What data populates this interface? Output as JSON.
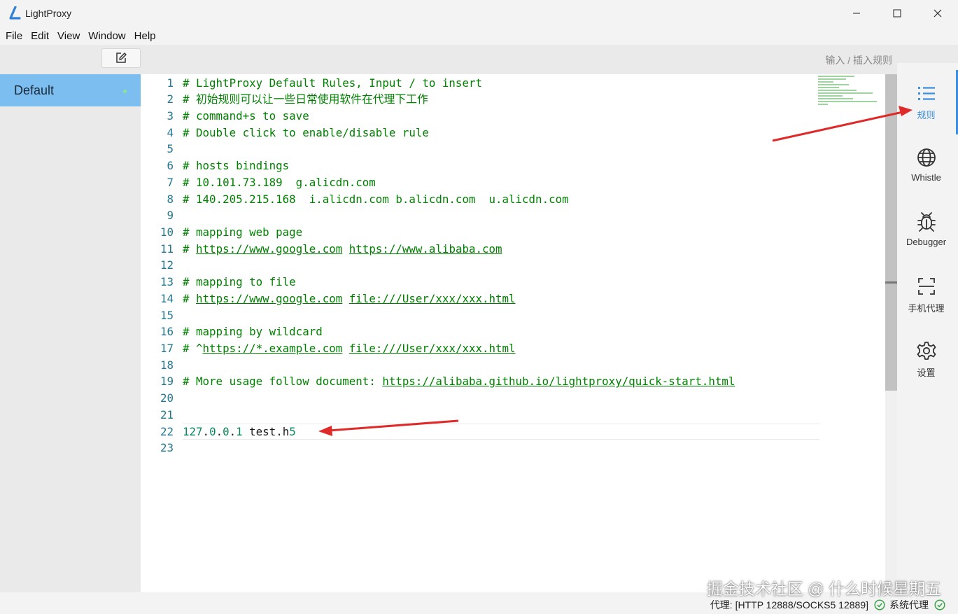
{
  "window": {
    "title": "LightProxy",
    "controls": [
      "minimize-icon",
      "maximize-icon",
      "close-icon"
    ]
  },
  "menu": [
    "File",
    "Edit",
    "Window",
    "Help",
    "View"
  ],
  "menu_order": [
    "File",
    "Edit",
    "View",
    "Window",
    "Help"
  ],
  "toolbar": {
    "new_rule_icon": "edit-icon",
    "hint": "输入 / 插入规则"
  },
  "sidebar": {
    "items": [
      {
        "label": "Default",
        "enabled": true
      }
    ]
  },
  "editor": {
    "lines": [
      {
        "n": "1",
        "text": "# LightProxy Default Rules, Input / to insert"
      },
      {
        "n": "2",
        "text": "# 初始规则可以让一些日常使用软件在代理下工作"
      },
      {
        "n": "3",
        "text": "# command+s to save"
      },
      {
        "n": "4",
        "text": "# Double click to enable/disable rule"
      },
      {
        "n": "5",
        "text": ""
      },
      {
        "n": "6",
        "text": "# hosts bindings"
      },
      {
        "n": "7",
        "text": "# 10.101.73.189  g.alicdn.com"
      },
      {
        "n": "8",
        "text": "# 140.205.215.168  i.alicdn.com b.alicdn.com  u.alicdn.com"
      },
      {
        "n": "9",
        "text": ""
      },
      {
        "n": "10",
        "text": "# mapping web page"
      },
      {
        "n": "11",
        "prefix": "# ",
        "links": [
          "https://www.google.com",
          "https://www.alibaba.com"
        ]
      },
      {
        "n": "12",
        "text": ""
      },
      {
        "n": "13",
        "text": "# mapping to file"
      },
      {
        "n": "14",
        "prefix": "# ",
        "links": [
          "https://www.google.com",
          "file:///User/xxx/xxx.html"
        ]
      },
      {
        "n": "15",
        "text": ""
      },
      {
        "n": "16",
        "text": "# mapping by wildcard"
      },
      {
        "n": "17",
        "prefix": "# ^",
        "links": [
          "https://*.example.com",
          "file:///User/xxx/xxx.html"
        ]
      },
      {
        "n": "18",
        "text": ""
      },
      {
        "n": "19",
        "prefix": "# More usage follow document: ",
        "links": [
          "https://alibaba.github.io/lightproxy/quick-start.html"
        ]
      },
      {
        "n": "20",
        "text": ""
      },
      {
        "n": "21",
        "text": ""
      },
      {
        "n": "22",
        "ip": "127.0.0.1",
        "host": "test.h",
        "host_num": "5"
      },
      {
        "n": "23",
        "text": ""
      }
    ]
  },
  "rail": [
    {
      "label": "规则",
      "icon": "list-icon",
      "active": true
    },
    {
      "label": "Whistle",
      "icon": "globe-icon",
      "active": false
    },
    {
      "label": "Debugger",
      "icon": "bug-icon",
      "active": false
    },
    {
      "label": "手机代理",
      "icon": "scan-icon",
      "active": false
    },
    {
      "label": "设置",
      "icon": "gear-icon",
      "active": false
    }
  ],
  "status": {
    "proxy": "代理: [HTTP 12888/SOCKS5 12889]",
    "system_proxy": "系统代理",
    "watermark": "掘金技术社区 @ 什么时候星期五"
  },
  "colors": {
    "comment": "#008000",
    "line_number": "#237893",
    "active_rule": "#7dbef0",
    "accent": "#3d8fe0",
    "arrow": "#e02a2a"
  }
}
